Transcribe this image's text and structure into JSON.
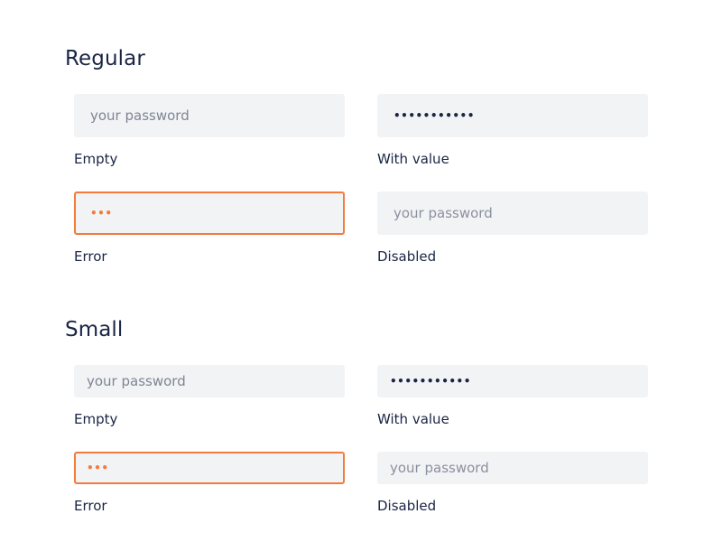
{
  "sections": [
    {
      "title": "Regular",
      "fields": [
        {
          "state": "empty",
          "placeholder": "your password",
          "value": "",
          "caption": "Empty"
        },
        {
          "state": "filled",
          "placeholder": "",
          "value": "•••••••••••",
          "caption": "With value"
        },
        {
          "state": "error",
          "placeholder": "",
          "value": "•••",
          "caption": "Error"
        },
        {
          "state": "disabled",
          "placeholder": "your password",
          "value": "",
          "caption": "Disabled"
        }
      ]
    },
    {
      "title": "Small",
      "fields": [
        {
          "state": "empty",
          "placeholder": "your password",
          "value": "",
          "caption": "Empty"
        },
        {
          "state": "filled",
          "placeholder": "",
          "value": "•••••••••••",
          "caption": "With value"
        },
        {
          "state": "error",
          "placeholder": "",
          "value": "•••",
          "caption": "Error"
        },
        {
          "state": "disabled",
          "placeholder": "your password",
          "value": "",
          "caption": "Disabled"
        }
      ]
    }
  ],
  "colors": {
    "field_background": "#f2f3f5",
    "error_border": "#f37b3d",
    "text_primary": "#1a2544",
    "placeholder": "#7d8594"
  }
}
